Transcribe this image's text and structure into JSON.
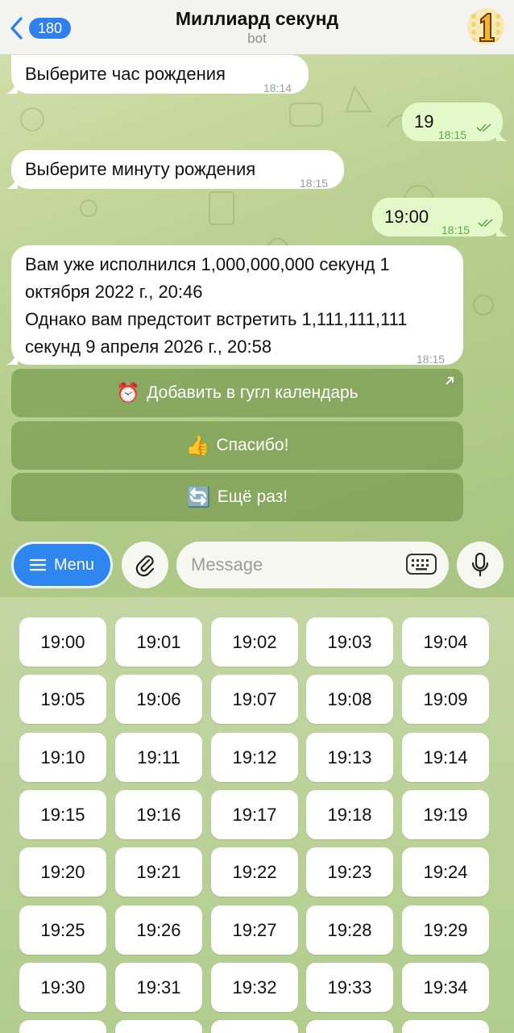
{
  "header": {
    "back_count": "180",
    "title": "Миллиард секунд",
    "subtitle": "bot",
    "avatar_icon": "number-one-badge-icon"
  },
  "messages": [
    {
      "dir": "in",
      "text": "Выберите час рождения",
      "time": "18:14"
    },
    {
      "dir": "out",
      "text": "19",
      "time": "18:15"
    },
    {
      "dir": "in",
      "text": "Выберите минуту рождения",
      "time": "18:15"
    },
    {
      "dir": "out",
      "text": "19:00",
      "time": "18:15"
    },
    {
      "dir": "in",
      "lines": [
        "Вам уже исполнился 1,000,000,000 секунд 1",
        "октября 2022 г., 20:46",
        "Однако вам предстоит встретить 1,111,111,111",
        "секунд 9 апреля 2026 г., 20:58"
      ],
      "time": "18:15"
    }
  ],
  "inline_buttons": [
    {
      "emoji": "⏰",
      "label": "Добавить в гугл календарь",
      "icon": "alarm-clock-icon",
      "external": true
    },
    {
      "emoji": "👍",
      "label": "Спасибо!",
      "icon": "thumbs-up-icon"
    },
    {
      "emoji": "🔄",
      "label": "Ещё раз!",
      "icon": "repeat-icon"
    }
  ],
  "input": {
    "menu_label": "Menu",
    "placeholder": "Message"
  },
  "keyboard": {
    "keys": [
      "19:00",
      "19:01",
      "19:02",
      "19:03",
      "19:04",
      "19:05",
      "19:06",
      "19:07",
      "19:08",
      "19:09",
      "19:10",
      "19:11",
      "19:12",
      "19:13",
      "19:14",
      "19:15",
      "19:16",
      "19:17",
      "19:18",
      "19:19",
      "19:20",
      "19:21",
      "19:22",
      "19:23",
      "19:24",
      "19:25",
      "19:26",
      "19:27",
      "19:28",
      "19:29",
      "19:30",
      "19:31",
      "19:32",
      "19:33",
      "19:34"
    ]
  },
  "colors": {
    "accent": "#2f86ee",
    "chat_bg": "#b7cf8f",
    "outgoing_bubble": "#e4f9c9",
    "read_tick": "#5fa84e"
  }
}
